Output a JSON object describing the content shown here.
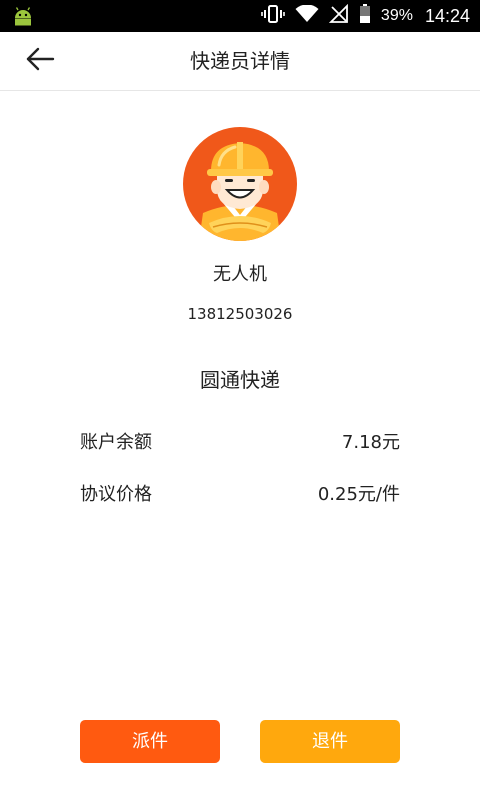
{
  "status_bar": {
    "battery_percent": "39%",
    "time": "14:24",
    "icons": [
      "android-icon",
      "vibrate-icon",
      "wifi-icon",
      "no-signal-icon",
      "battery-icon"
    ]
  },
  "header": {
    "title": "快递员详情",
    "back_icon": "arrow-left-icon"
  },
  "courier": {
    "avatar_icon": "courier-avatar-icon",
    "name": "无人机",
    "phone": "13812503026",
    "company": "圆通快递"
  },
  "details": [
    {
      "label": "账户余额",
      "value": "7.18元"
    },
    {
      "label": "协议价格",
      "value": "0.25元/件"
    }
  ],
  "actions": {
    "dispatch_label": "派件",
    "return_label": "退件"
  },
  "colors": {
    "dispatch_button": "#ff5a10",
    "return_button": "#ffa80d",
    "avatar_background": "#f0581a",
    "helmet": "#ffb62e"
  }
}
